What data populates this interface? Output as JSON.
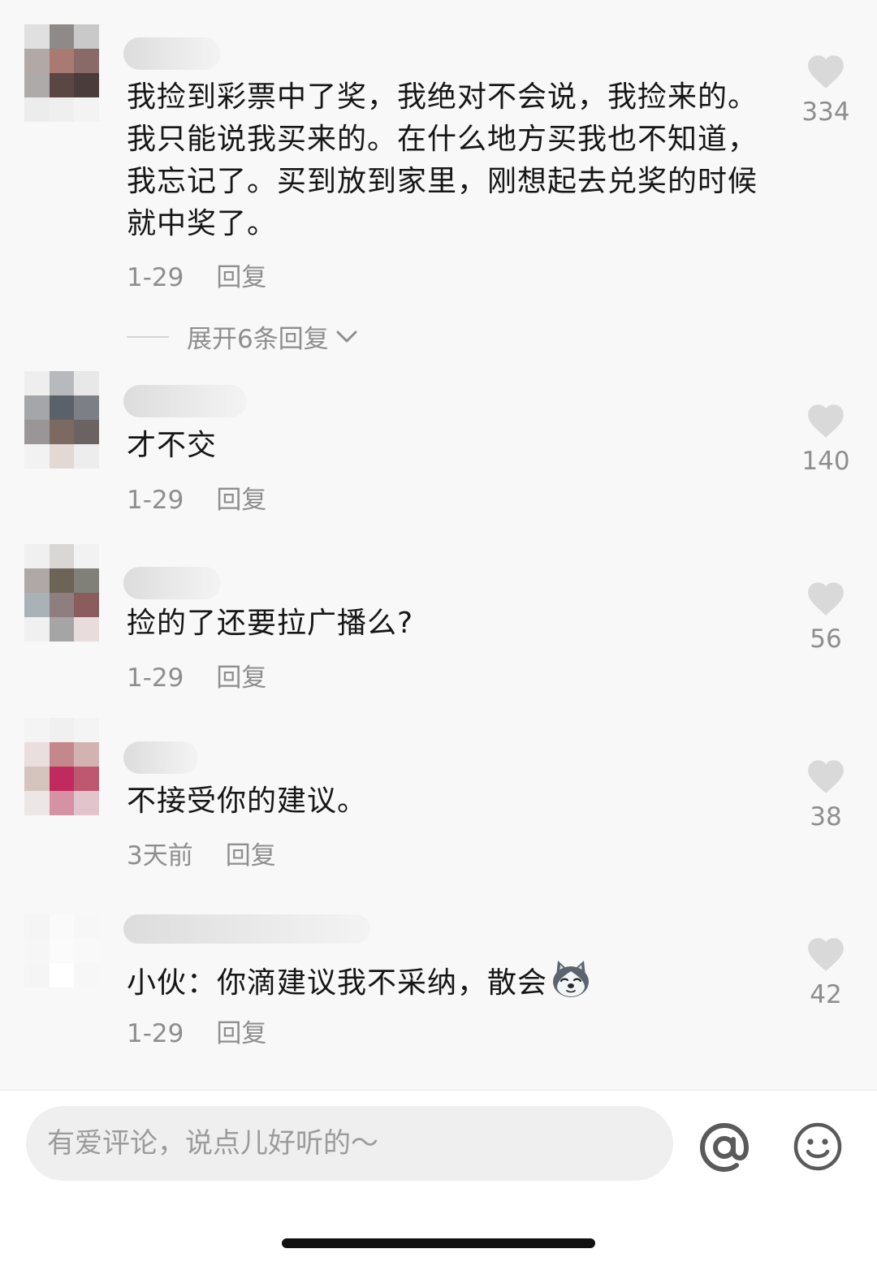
{
  "comments": [
    {
      "text": "我捡到彩票中了奖，我绝对不会说，我捡来的。我只能说我买来的。在什么地方买我也不知道，我忘记了。买到放到家里，刚想起去兑奖的时候就中奖了。",
      "date": "1-29",
      "reply_label": "回复",
      "likes": "334"
    },
    {
      "text": "才不交",
      "date": "1-29",
      "reply_label": "回复",
      "likes": "140"
    },
    {
      "text": "捡的了还要拉广播么?",
      "date": "1-29",
      "reply_label": "回复",
      "likes": "56"
    },
    {
      "text": "不接受你的建议。",
      "date": "3天前",
      "reply_label": "回复",
      "likes": "38"
    },
    {
      "text": "小伙：你滴建议我不采纳，散会",
      "date": "1-29",
      "reply_label": "回复",
      "likes": "42",
      "emoji": "husky-dog-emoji"
    }
  ],
  "expand_replies": {
    "label": "展开6条回复",
    "icon": "chevron-down-icon"
  },
  "input_bar": {
    "placeholder": "有爱评论，说点儿好听的～",
    "at_icon": "at-icon",
    "emoji_icon": "smile-icon"
  },
  "colors": {
    "background": "#f8f8f8",
    "text_primary": "#161616",
    "text_secondary": "#8e8e8e",
    "like_icon": "#d9d9d9",
    "input_background": "#efefef"
  }
}
